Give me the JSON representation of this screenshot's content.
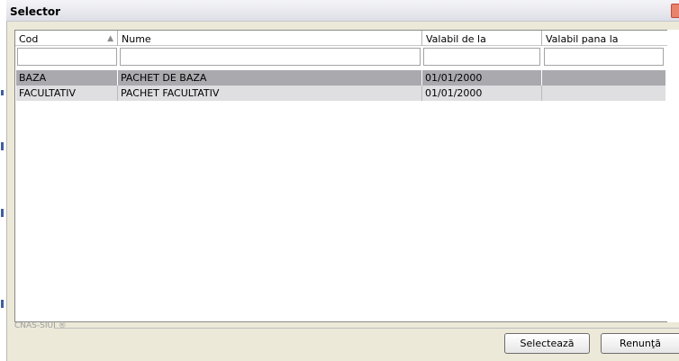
{
  "window": {
    "title": "Selector"
  },
  "grid": {
    "columns": [
      {
        "label": "Cod",
        "sorted": "ascending"
      },
      {
        "label": "Nume"
      },
      {
        "label": "Valabil de la"
      },
      {
        "label": "Valabil pana la"
      }
    ],
    "filters": [
      "",
      "",
      "",
      ""
    ],
    "rows": [
      {
        "cod": "BAZA",
        "nume": "PACHET DE BAZA",
        "valabil_de_la": "01/01/2000",
        "valabil_pana_la": "",
        "selected": true
      },
      {
        "cod": "FACULTATIV",
        "nume": "PACHET FACULTATIV",
        "valabil_de_la": "01/01/2000",
        "valabil_pana_la": "",
        "selected": false
      }
    ]
  },
  "footer": {
    "brand": "CNAS-SIUI ®"
  },
  "buttons": {
    "select_label": "Selectează",
    "cancel_label": "Renunţă"
  },
  "colors": {
    "selected_row": "#a9a9ae",
    "alternate_row": "#dfdfe1",
    "background": "#ece9d8"
  }
}
